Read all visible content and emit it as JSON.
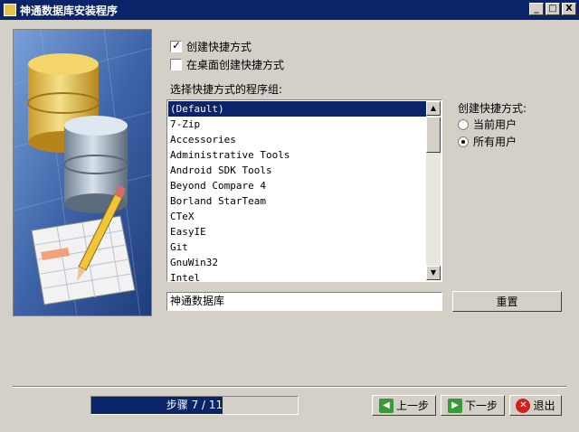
{
  "window": {
    "title": "神通数据库安装程序",
    "minimize": "_",
    "maximize": "□",
    "close": "X"
  },
  "options": {
    "create_shortcut": {
      "label": "创建快捷方式",
      "checked": true
    },
    "desktop_shortcut": {
      "label": "在桌面创建快捷方式",
      "checked": false
    }
  },
  "program_group": {
    "label": "选择快捷方式的程序组:",
    "items": [
      "(Default)",
      "7-Zip",
      "Accessories",
      "Administrative Tools",
      "Android SDK Tools",
      "Beyond Compare 4",
      "Borland StarTeam",
      "CTeX",
      "EasyIE",
      "Git",
      "GnuWin32",
      "Intel"
    ],
    "selected_index": 0,
    "value": "神通数据库",
    "reset_label": "重置"
  },
  "shortcut_mode": {
    "label": "创建快捷方式:",
    "options": [
      {
        "label": "当前用户",
        "checked": false
      },
      {
        "label": "所有用户",
        "checked": true
      }
    ]
  },
  "progress": {
    "text": "步骤 7 / 11",
    "current": 7,
    "total": 11
  },
  "nav": {
    "prev_label": "上一步",
    "next_label": "下一步",
    "exit_label": "退出"
  },
  "colors": {
    "title_bar": "#0a246a",
    "selection": "#0a246a",
    "face": "#d4d0c8"
  }
}
